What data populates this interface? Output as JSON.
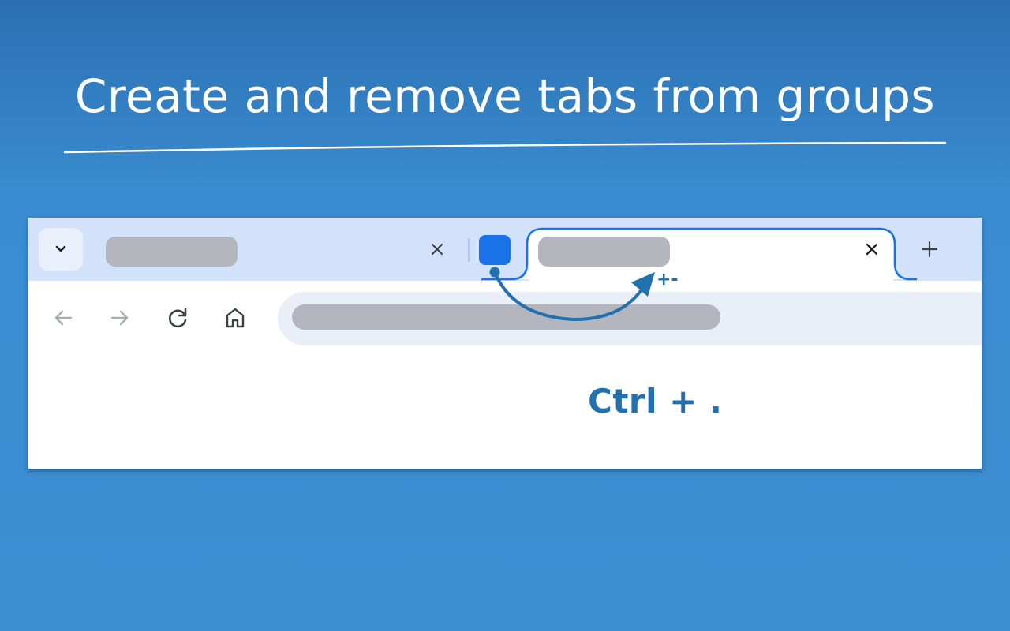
{
  "headline": "Create and remove tabs from groups",
  "colors": {
    "background": "#3a8bcf",
    "tabstrip": "#d3e2fb",
    "group_accent": "#1a73e8",
    "annotation": "#2270b0",
    "placeholder": "#b3b6bc"
  },
  "tabstrip": {
    "search_icon": "chevron-down-icon",
    "tabs": [
      {
        "close_icon": "close-icon",
        "grouped": false
      },
      {
        "close_icon": "close-icon",
        "grouped": true,
        "active": true
      }
    ],
    "new_tab_icon": "plus-icon"
  },
  "toolbar": {
    "icons": [
      "arrow-left-icon",
      "arrow-right-icon",
      "reload-icon",
      "home-icon"
    ]
  },
  "annotation": {
    "plus_minus": "+-",
    "shortcut": "Ctrl + ."
  }
}
